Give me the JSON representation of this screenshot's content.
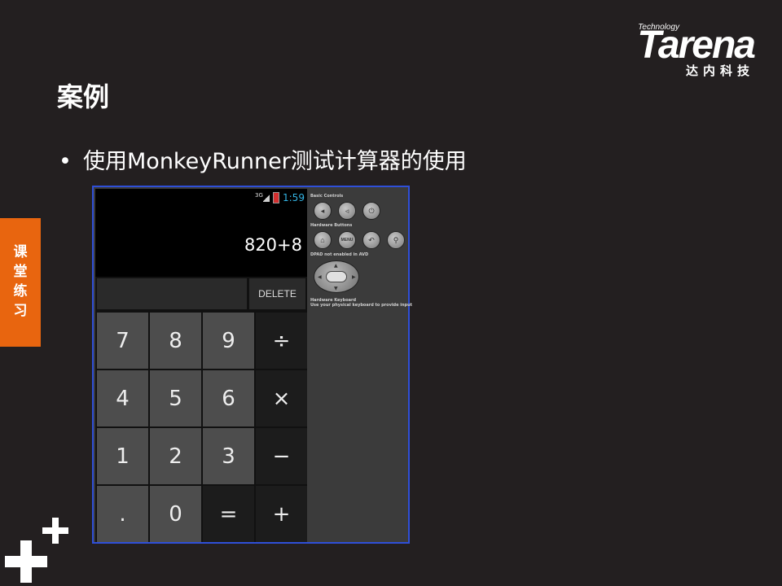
{
  "logo": {
    "tagline": "Technology",
    "word": "Tarena",
    "cn": "达内科技"
  },
  "title": "案例",
  "bullet": {
    "marker": "•",
    "text": "使用MonkeyRunner测试计算器的使用"
  },
  "side_tab": [
    "课",
    "堂",
    "练",
    "习"
  ],
  "emulator": {
    "status": {
      "network": "3G",
      "time": "1:59",
      "accent": "#33b5e5"
    },
    "display": "820+8",
    "delete_label": "DELETE",
    "keys": [
      [
        "7",
        "8",
        "9",
        "÷"
      ],
      [
        "4",
        "5",
        "6",
        "×"
      ],
      [
        "1",
        "2",
        "3",
        "−"
      ],
      [
        ".",
        "0",
        "=",
        "+"
      ]
    ],
    "controls": {
      "basic_label": "Basic Controls",
      "hardware_label": "Hardware Buttons",
      "menu_label": "MENU",
      "dpad_label": "DPAD not enabled in AVD",
      "keyboard_title": "Hardware Keyboard",
      "keyboard_hint": "Use your physical keyboard to provide input"
    }
  },
  "colors": {
    "background": "#231f20",
    "side_tab": "#e8650f",
    "emulator_border": "#2f4fd8"
  }
}
